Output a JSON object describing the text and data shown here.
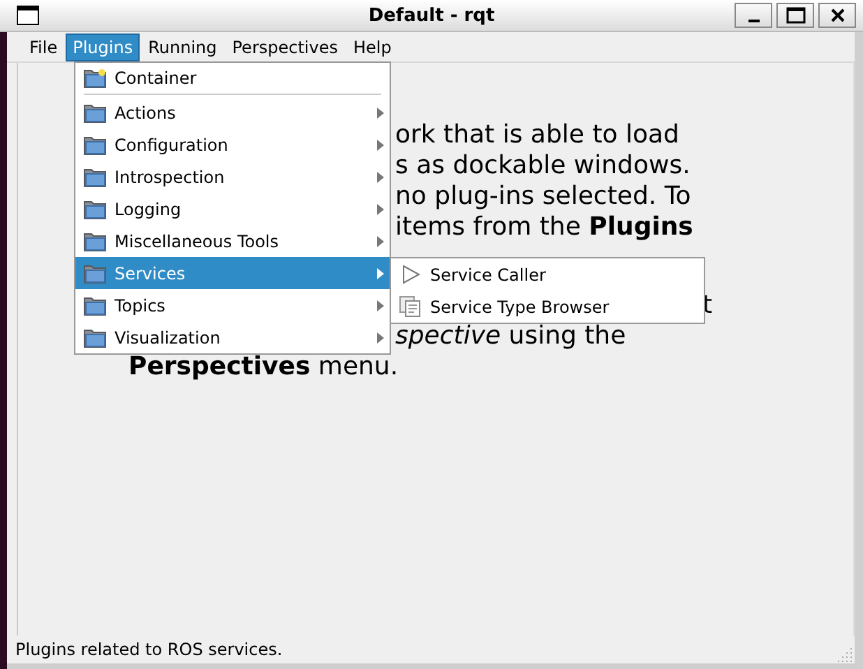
{
  "window": {
    "title": "Default - rqt",
    "controls": [
      {
        "kind": "minimize"
      },
      {
        "kind": "maximize"
      },
      {
        "kind": "close"
      }
    ]
  },
  "menubar": [
    {
      "label": "File",
      "selected": false
    },
    {
      "label": "Plugins",
      "selected": true
    },
    {
      "label": "Running",
      "selected": false
    },
    {
      "label": "Perspectives",
      "selected": false
    },
    {
      "label": "Help",
      "selected": false
    }
  ],
  "background_text": [
    {
      "text": "ork that is able to load",
      "kind": "beside-menu"
    },
    {
      "text": "s as dockable windows.",
      "kind": "beside-menu"
    },
    {
      "text": "no plug-ins selected. To",
      "kind": "beside-menu"
    },
    {
      "text": "items from the **Plugins**",
      "kind": "beside-menu"
    },
    {
      "text": "t",
      "kind": "beside-submenu"
    },
    {
      "text": "*spective* using the",
      "kind": "beside-menu"
    },
    {
      "text": "**Perspectives** menu.",
      "kind": "full"
    }
  ],
  "plugins_menu": {
    "items": [
      {
        "label": "Container",
        "kind": "container",
        "has_submenu": false,
        "selected": false
      },
      {
        "kind": "separator"
      },
      {
        "label": "Actions",
        "kind": "folder",
        "has_submenu": true,
        "selected": false
      },
      {
        "label": "Configuration",
        "kind": "folder",
        "has_submenu": true,
        "selected": false
      },
      {
        "label": "Introspection",
        "kind": "folder",
        "has_submenu": true,
        "selected": false
      },
      {
        "label": "Logging",
        "kind": "folder",
        "has_submenu": true,
        "selected": false
      },
      {
        "label": "Miscellaneous Tools",
        "kind": "folder",
        "has_submenu": true,
        "selected": false
      },
      {
        "label": "Services",
        "kind": "folder",
        "has_submenu": true,
        "selected": true
      },
      {
        "label": "Topics",
        "kind": "folder",
        "has_submenu": true,
        "selected": false
      },
      {
        "label": "Visualization",
        "kind": "folder",
        "has_submenu": true,
        "selected": false
      }
    ]
  },
  "services_submenu": {
    "items": [
      {
        "label": "Service Caller",
        "kind": "play"
      },
      {
        "label": "Service Type Browser",
        "kind": "document"
      }
    ]
  },
  "status_bar": {
    "text": "Plugins related to ROS services."
  }
}
